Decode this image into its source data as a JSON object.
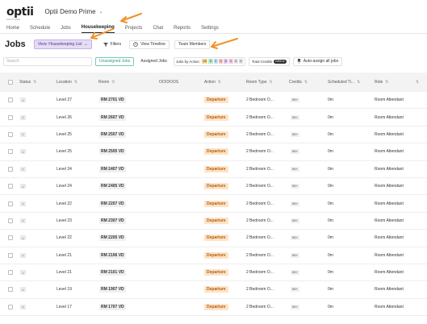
{
  "app": {
    "logo": "optii",
    "logo_sub": "SOLUTIONS",
    "property_name": "Optii Demo Prime"
  },
  "nav": {
    "items": [
      "Home",
      "Schedule",
      "Jobs",
      "Housekeeping",
      "Projects",
      "Chat",
      "Reports",
      "Settings"
    ],
    "active": "Housekeeping"
  },
  "toolbar": {
    "title": "Jobs",
    "view_label": "View: Housekeeping List",
    "filters_label": "Filters",
    "view_timeline_label": "View Timeline",
    "team_members_label": "Team Members"
  },
  "filters": {
    "search_placeholder": "Search",
    "unassigned_label": "Unassigned Jobs",
    "assigned_label": "Assigned Jobs",
    "jobs_by_action_label": "Jobs by Action",
    "action_chips": [
      {
        "value": "26",
        "color": "#f7d98b"
      },
      {
        "value": "0",
        "color": "#b8e6c8"
      },
      {
        "value": "0",
        "color": "#bfe0f5"
      },
      {
        "value": "0",
        "color": "#f7c4c4"
      },
      {
        "value": "0",
        "color": "#d8c8f0"
      },
      {
        "value": "0",
        "color": "#f4c9e0"
      },
      {
        "value": "0",
        "color": "#e0e0e0"
      },
      {
        "value": "0",
        "color": "#e0e0e0"
      }
    ],
    "total_credits_label": "Total Credits",
    "total_credits_value": "2300 cr",
    "auto_assign_label": "Auto-assign all jobs"
  },
  "table": {
    "headers": [
      "Status",
      "Location",
      "Room",
      "OOO/OOS",
      "Action",
      "Room Type",
      "Credits",
      "Scheduled Ti...",
      "Role"
    ],
    "rows": [
      {
        "location": "Level 27",
        "room": "RM 2701",
        "tag": "VD",
        "action": "Departure",
        "room_type": "2 Bedroom O...",
        "credits": "99+",
        "sched": "0m",
        "role": "Room Attendant"
      },
      {
        "location": "Level 26",
        "room": "RM 2607",
        "tag": "VD",
        "action": "Departure",
        "room_type": "2 Bedroom O...",
        "credits": "99+",
        "sched": "0m",
        "role": "Room Attendant"
      },
      {
        "location": "Level 25",
        "room": "RM 2507",
        "tag": "VD",
        "action": "Departure",
        "room_type": "2 Bedroom O...",
        "credits": "99+",
        "sched": "0m",
        "role": "Room Attendant"
      },
      {
        "location": "Level 25",
        "room": "RM 2505",
        "tag": "VD",
        "action": "Departure",
        "room_type": "2 Bedroom O...",
        "credits": "99+",
        "sched": "0m",
        "role": "Room Attendant"
      },
      {
        "location": "Level 24",
        "room": "RM 2407",
        "tag": "VD",
        "action": "Departure",
        "room_type": "2 Bedroom O...",
        "credits": "99+",
        "sched": "0m",
        "role": "Room Attendant"
      },
      {
        "location": "Level 24",
        "room": "RM 2405",
        "tag": "VD",
        "action": "Departure",
        "room_type": "2 Bedroom O...",
        "credits": "99+",
        "sched": "0m",
        "role": "Room Attendant"
      },
      {
        "location": "Level 22",
        "room": "RM 2207",
        "tag": "VD",
        "action": "Departure",
        "room_type": "2 Bedroom O...",
        "credits": "99+",
        "sched": "0m",
        "role": "Room Attendant"
      },
      {
        "location": "Level 23",
        "room": "RM 2307",
        "tag": "VD",
        "action": "Departure",
        "room_type": "2 Bedroom O...",
        "credits": "99+",
        "sched": "0m",
        "role": "Room Attendant"
      },
      {
        "location": "Level 22",
        "room": "RM 2205",
        "tag": "VD",
        "action": "Departure",
        "room_type": "2 Bedroom O...",
        "credits": "99+",
        "sched": "0m",
        "role": "Room Attendant"
      },
      {
        "location": "Level 21",
        "room": "RM 2106",
        "tag": "VD",
        "action": "Departure",
        "room_type": "2 Bedroom O...",
        "credits": "99+",
        "sched": "0m",
        "role": "Room Attendant"
      },
      {
        "location": "Level 21",
        "room": "RM 2101",
        "tag": "VD",
        "action": "Departure",
        "room_type": "2 Bedroom O...",
        "credits": "99+",
        "sched": "0m",
        "role": "Room Attendant"
      },
      {
        "location": "Level 19",
        "room": "RM 1907",
        "tag": "VD",
        "action": "Departure",
        "room_type": "2 Bedroom O...",
        "credits": "99+",
        "sched": "0m",
        "role": "Room Attendant"
      },
      {
        "location": "Level 17",
        "room": "RM 1707",
        "tag": "VD",
        "action": "Departure",
        "room_type": "2 Bedroom O...",
        "credits": "99+",
        "sched": "0m",
        "role": "Room Attendant"
      }
    ]
  },
  "annotation_color": "#f0922a"
}
